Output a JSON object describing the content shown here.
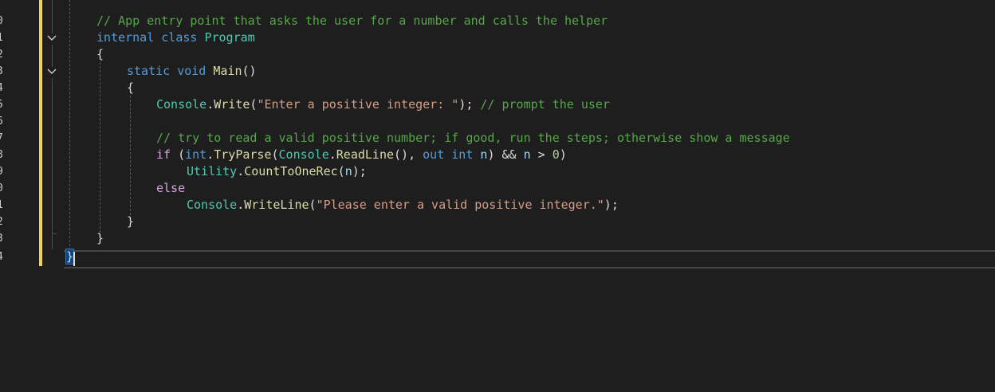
{
  "colors": {
    "background": "#1e1e1e",
    "change_bar": "#f0d35b",
    "comment": "#57a64a",
    "keyword": "#569cd6",
    "control_keyword": "#d8a0df",
    "type": "#4ec9b0",
    "method": "#dcdcaa",
    "string": "#d69d85",
    "local": "#9cdcfe",
    "number": "#b5cea8"
  },
  "gutter": {
    "line_numbers": [
      "9",
      "0",
      "1",
      "2",
      "3",
      "4",
      "5",
      "6",
      "7",
      "8",
      "9",
      "0",
      "1",
      "2",
      "3",
      "4"
    ],
    "fold_icons": [
      "chevron-down-icon",
      "chevron-down-icon"
    ]
  },
  "code": {
    "line1": {
      "comment": "// App entry point that asks the user for a number and calls the helper"
    },
    "line2": {
      "kw1": "internal",
      "kw2": "class",
      "type": "Program"
    },
    "line3": {
      "brace": "{"
    },
    "line4": {
      "kw1": "static",
      "kw2": "void",
      "method": "Main",
      "parens": "()"
    },
    "line5": {
      "brace": "{"
    },
    "line6": {
      "type": "Console",
      "dot": ".",
      "method": "Write",
      "open": "(",
      "string": "\"Enter a positive integer: \"",
      "close": ");",
      "comment": "// prompt the user"
    },
    "line8": {
      "comment": "// try to read a valid positive number; if good, run the steps; otherwise show a message"
    },
    "line9": {
      "kw_if": "if",
      "open": " (",
      "kw_int": "int",
      "dot1": ".",
      "method1": "TryParse",
      "open2": "(",
      "type": "Console",
      "dot2": ".",
      "method2": "ReadLine",
      "call": "(), ",
      "kw_out": "out",
      "kw_int2": "int",
      "var1": "n",
      "and": ") && ",
      "var2": "n",
      "gt": " > ",
      "number": "0",
      "close": ")"
    },
    "line10": {
      "type": "Utility",
      "dot": ".",
      "method": "CountToOneRec",
      "open": "(",
      "var": "n",
      "close": ");"
    },
    "line11": {
      "kw": "else"
    },
    "line12": {
      "type": "Console",
      "dot": ".",
      "method": "WriteLine",
      "open": "(",
      "string": "\"Please enter a valid positive integer.\"",
      "close": ");"
    },
    "line13": {
      "brace": "}"
    },
    "line14": {
      "brace": "}"
    },
    "line15": {
      "brace": "}"
    }
  }
}
